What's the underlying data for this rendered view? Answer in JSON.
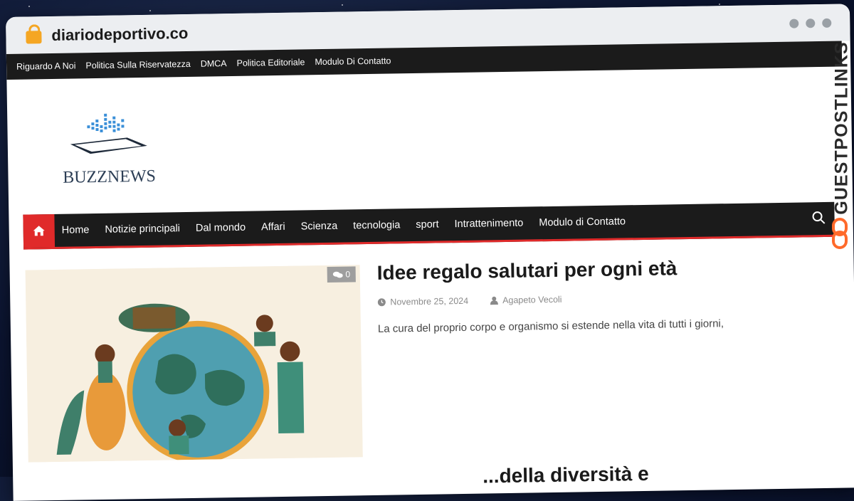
{
  "browser": {
    "url": "diariodeportivo.co"
  },
  "top_menu": {
    "items": [
      {
        "label": "Riguardo A Noi"
      },
      {
        "label": "Politica Sulla Riservatezza"
      },
      {
        "label": "DMCA"
      },
      {
        "label": "Politica Editoriale"
      },
      {
        "label": "Modulo Di Contatto"
      }
    ]
  },
  "logo": {
    "text": "BUZZNEWS"
  },
  "main_nav": {
    "items": [
      {
        "label": "Home"
      },
      {
        "label": "Notizie principali"
      },
      {
        "label": "Dal mondo"
      },
      {
        "label": "Affari"
      },
      {
        "label": "Scienza"
      },
      {
        "label": "tecnologia"
      },
      {
        "label": "sport"
      },
      {
        "label": "Intrattenimento"
      },
      {
        "label": "Modulo di Contatto"
      }
    ]
  },
  "article": {
    "comment_count": "0",
    "title": "Idee regalo salutari per ogni età",
    "date": "Novembre 25, 2024",
    "author": "Agapeto Vecoli",
    "excerpt": "La cura del proprio corpo e organismo si estende nella vita di tutti i giorni,"
  },
  "next_article": {
    "title_fragment": "...della diversità e"
  },
  "watermark": {
    "text": "GUESTPOSTLINKS"
  },
  "colors": {
    "accent": "#e02a2a",
    "nav_bg": "#1b1b1b",
    "lock": "#f5a623"
  },
  "icons": {
    "home": "home-icon",
    "search": "search-icon",
    "clock": "clock-icon",
    "user": "user-icon",
    "comments": "comments-icon"
  }
}
